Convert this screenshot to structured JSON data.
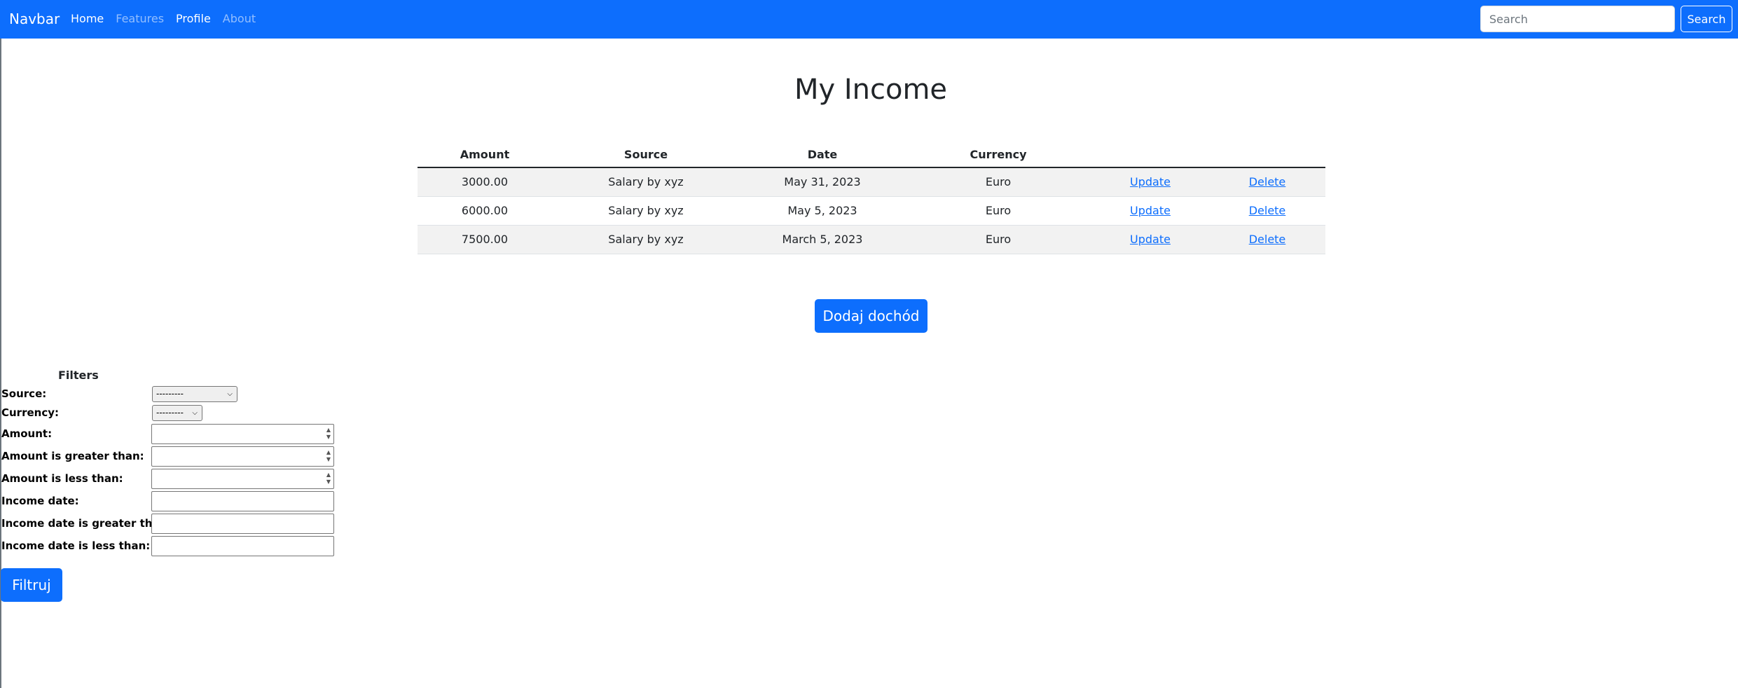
{
  "navbar": {
    "brand": "Navbar",
    "links": [
      {
        "label": "Home",
        "active": true
      },
      {
        "label": "Features",
        "active": false
      },
      {
        "label": "Profile",
        "active": true
      },
      {
        "label": "About",
        "active": false
      }
    ],
    "search_placeholder": "Search",
    "search_button": "Search"
  },
  "page": {
    "title": "My Income"
  },
  "table": {
    "headers": [
      "Amount",
      "Source",
      "Date",
      "Currency",
      "",
      ""
    ],
    "rows": [
      {
        "amount": "3000.00",
        "source": "Salary by xyz",
        "date": "May 31, 2023",
        "currency": "Euro",
        "update": "Update",
        "delete": "Delete"
      },
      {
        "amount": "6000.00",
        "source": "Salary by xyz",
        "date": "May 5, 2023",
        "currency": "Euro",
        "update": "Update",
        "delete": "Delete"
      },
      {
        "amount": "7500.00",
        "source": "Salary by xyz",
        "date": "March 5, 2023",
        "currency": "Euro",
        "update": "Update",
        "delete": "Delete"
      }
    ]
  },
  "add_button": "Dodaj dochód",
  "filters": {
    "title": "Filters",
    "source_label": "Source:",
    "source_value": "---------",
    "currency_label": "Currency:",
    "currency_value": "---------",
    "amount_label": "Amount:",
    "amount_gt_label": "Amount is greater than:",
    "amount_lt_label": "Amount is less than:",
    "date_label": "Income date:",
    "date_gt_label": "Income date is greater than:",
    "date_lt_label": "Income date is less than:",
    "submit": "Filtruj"
  },
  "colors": {
    "primary": "#0d6efd",
    "stripe": "#f2f2f2"
  }
}
